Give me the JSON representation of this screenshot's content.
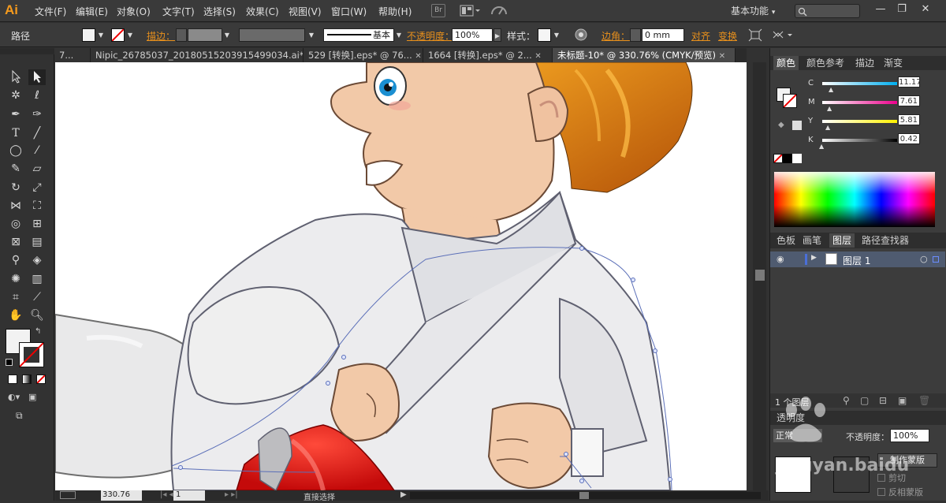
{
  "app": {
    "logo": "Ai"
  },
  "menus": [
    "文件(F)",
    "编辑(E)",
    "对象(O)",
    "文字(T)",
    "选择(S)",
    "效果(C)",
    "视图(V)",
    "窗口(W)",
    "帮助(H)"
  ],
  "menubar_icons": {
    "bridge": "Br",
    "arrange": "arrange-documents-icon",
    "gpu": "gpu-performance-icon"
  },
  "workspace": {
    "label": "基本功能",
    "caret": "▾"
  },
  "window_buttons": {
    "minimize": "—",
    "restore": "❐",
    "close": "✕"
  },
  "control": {
    "selection_type": "路径",
    "stroke_label": "描边：",
    "stroke_style": "基本",
    "opacity_label": "不透明度：",
    "opacity_value": "100%",
    "style_label": "样式：",
    "corner_label": "边角：",
    "corner_value": "0 mm",
    "align_label": "对齐",
    "transform_label": "变换",
    "stroke_fill_color": "#f2f2f2",
    "accent_color": "#e8901c"
  },
  "tabs": [
    {
      "label": "7..."
    },
    {
      "label": "Nipic_26785037_20180515203915499034.ai*"
    },
    {
      "label": "529 [转换].eps* @ 76..."
    },
    {
      "label": "1664 [转换].eps* @ 2..."
    },
    {
      "label": "未标题-10* @ 330.76% (CMYK/预览)",
      "active": true
    }
  ],
  "status": {
    "zoom": "330.76",
    "page": "1",
    "tool": "直接选择"
  },
  "panels": {
    "color_tabs": [
      "颜色",
      "颜色参考",
      "描边",
      "渐变"
    ],
    "cmyk": [
      {
        "channel": "C",
        "value": "11.17",
        "color": "#00aeef"
      },
      {
        "channel": "M",
        "value": "7.61",
        "color": "#ec008c"
      },
      {
        "channel": "Y",
        "value": "5.81",
        "color": "#fff200"
      },
      {
        "channel": "K",
        "value": "0.42",
        "color": "#000000"
      }
    ],
    "layer_tabs": [
      "色板",
      "画笔",
      "图层",
      "路径查找器"
    ],
    "layers": [
      {
        "name": "图层 1"
      }
    ],
    "layer_count": "1 个图层",
    "transparency_title": "透明度",
    "transparency_mode": "正常",
    "transparency_value": "100%",
    "make_mask": "制作蒙版",
    "clip": "剪切",
    "invert_mask": "反相蒙版"
  },
  "watermark": "jingyan.baidu"
}
